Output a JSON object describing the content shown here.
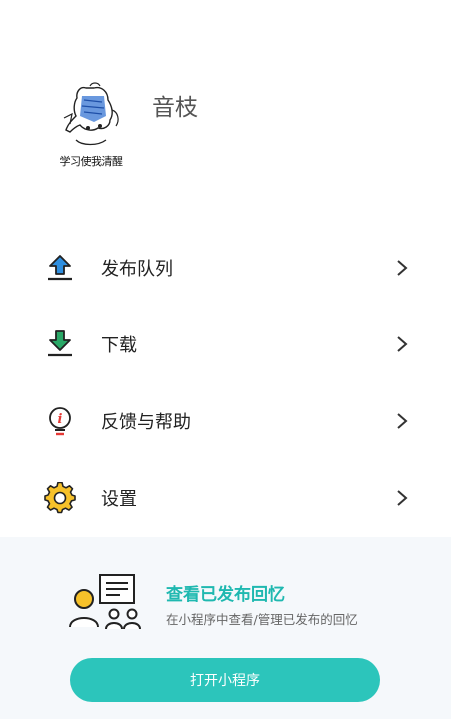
{
  "profile": {
    "avatar_caption": "学习使我清醒",
    "username": "音枝"
  },
  "menu": {
    "items": [
      {
        "label": "发布队列",
        "icon": "upload-tray-icon"
      },
      {
        "label": "下载",
        "icon": "download-tray-icon"
      },
      {
        "label": "反馈与帮助",
        "icon": "lightbulb-icon"
      },
      {
        "label": "设置",
        "icon": "gear-icon"
      }
    ],
    "chevron_icon": "chevron-right-icon"
  },
  "promo": {
    "title": "查看已发布回忆",
    "subtitle": "在小程序中查看/管理已发布的回忆",
    "button_label": "打开小程序",
    "illustration_icon": "document-people-icon"
  },
  "colors": {
    "accent": "#2cc5bb",
    "accent_text": "#1fb8b0",
    "icon_blue": "#2f8fe0",
    "icon_green": "#2aa867",
    "promo_bg": "#f5f8fb"
  }
}
